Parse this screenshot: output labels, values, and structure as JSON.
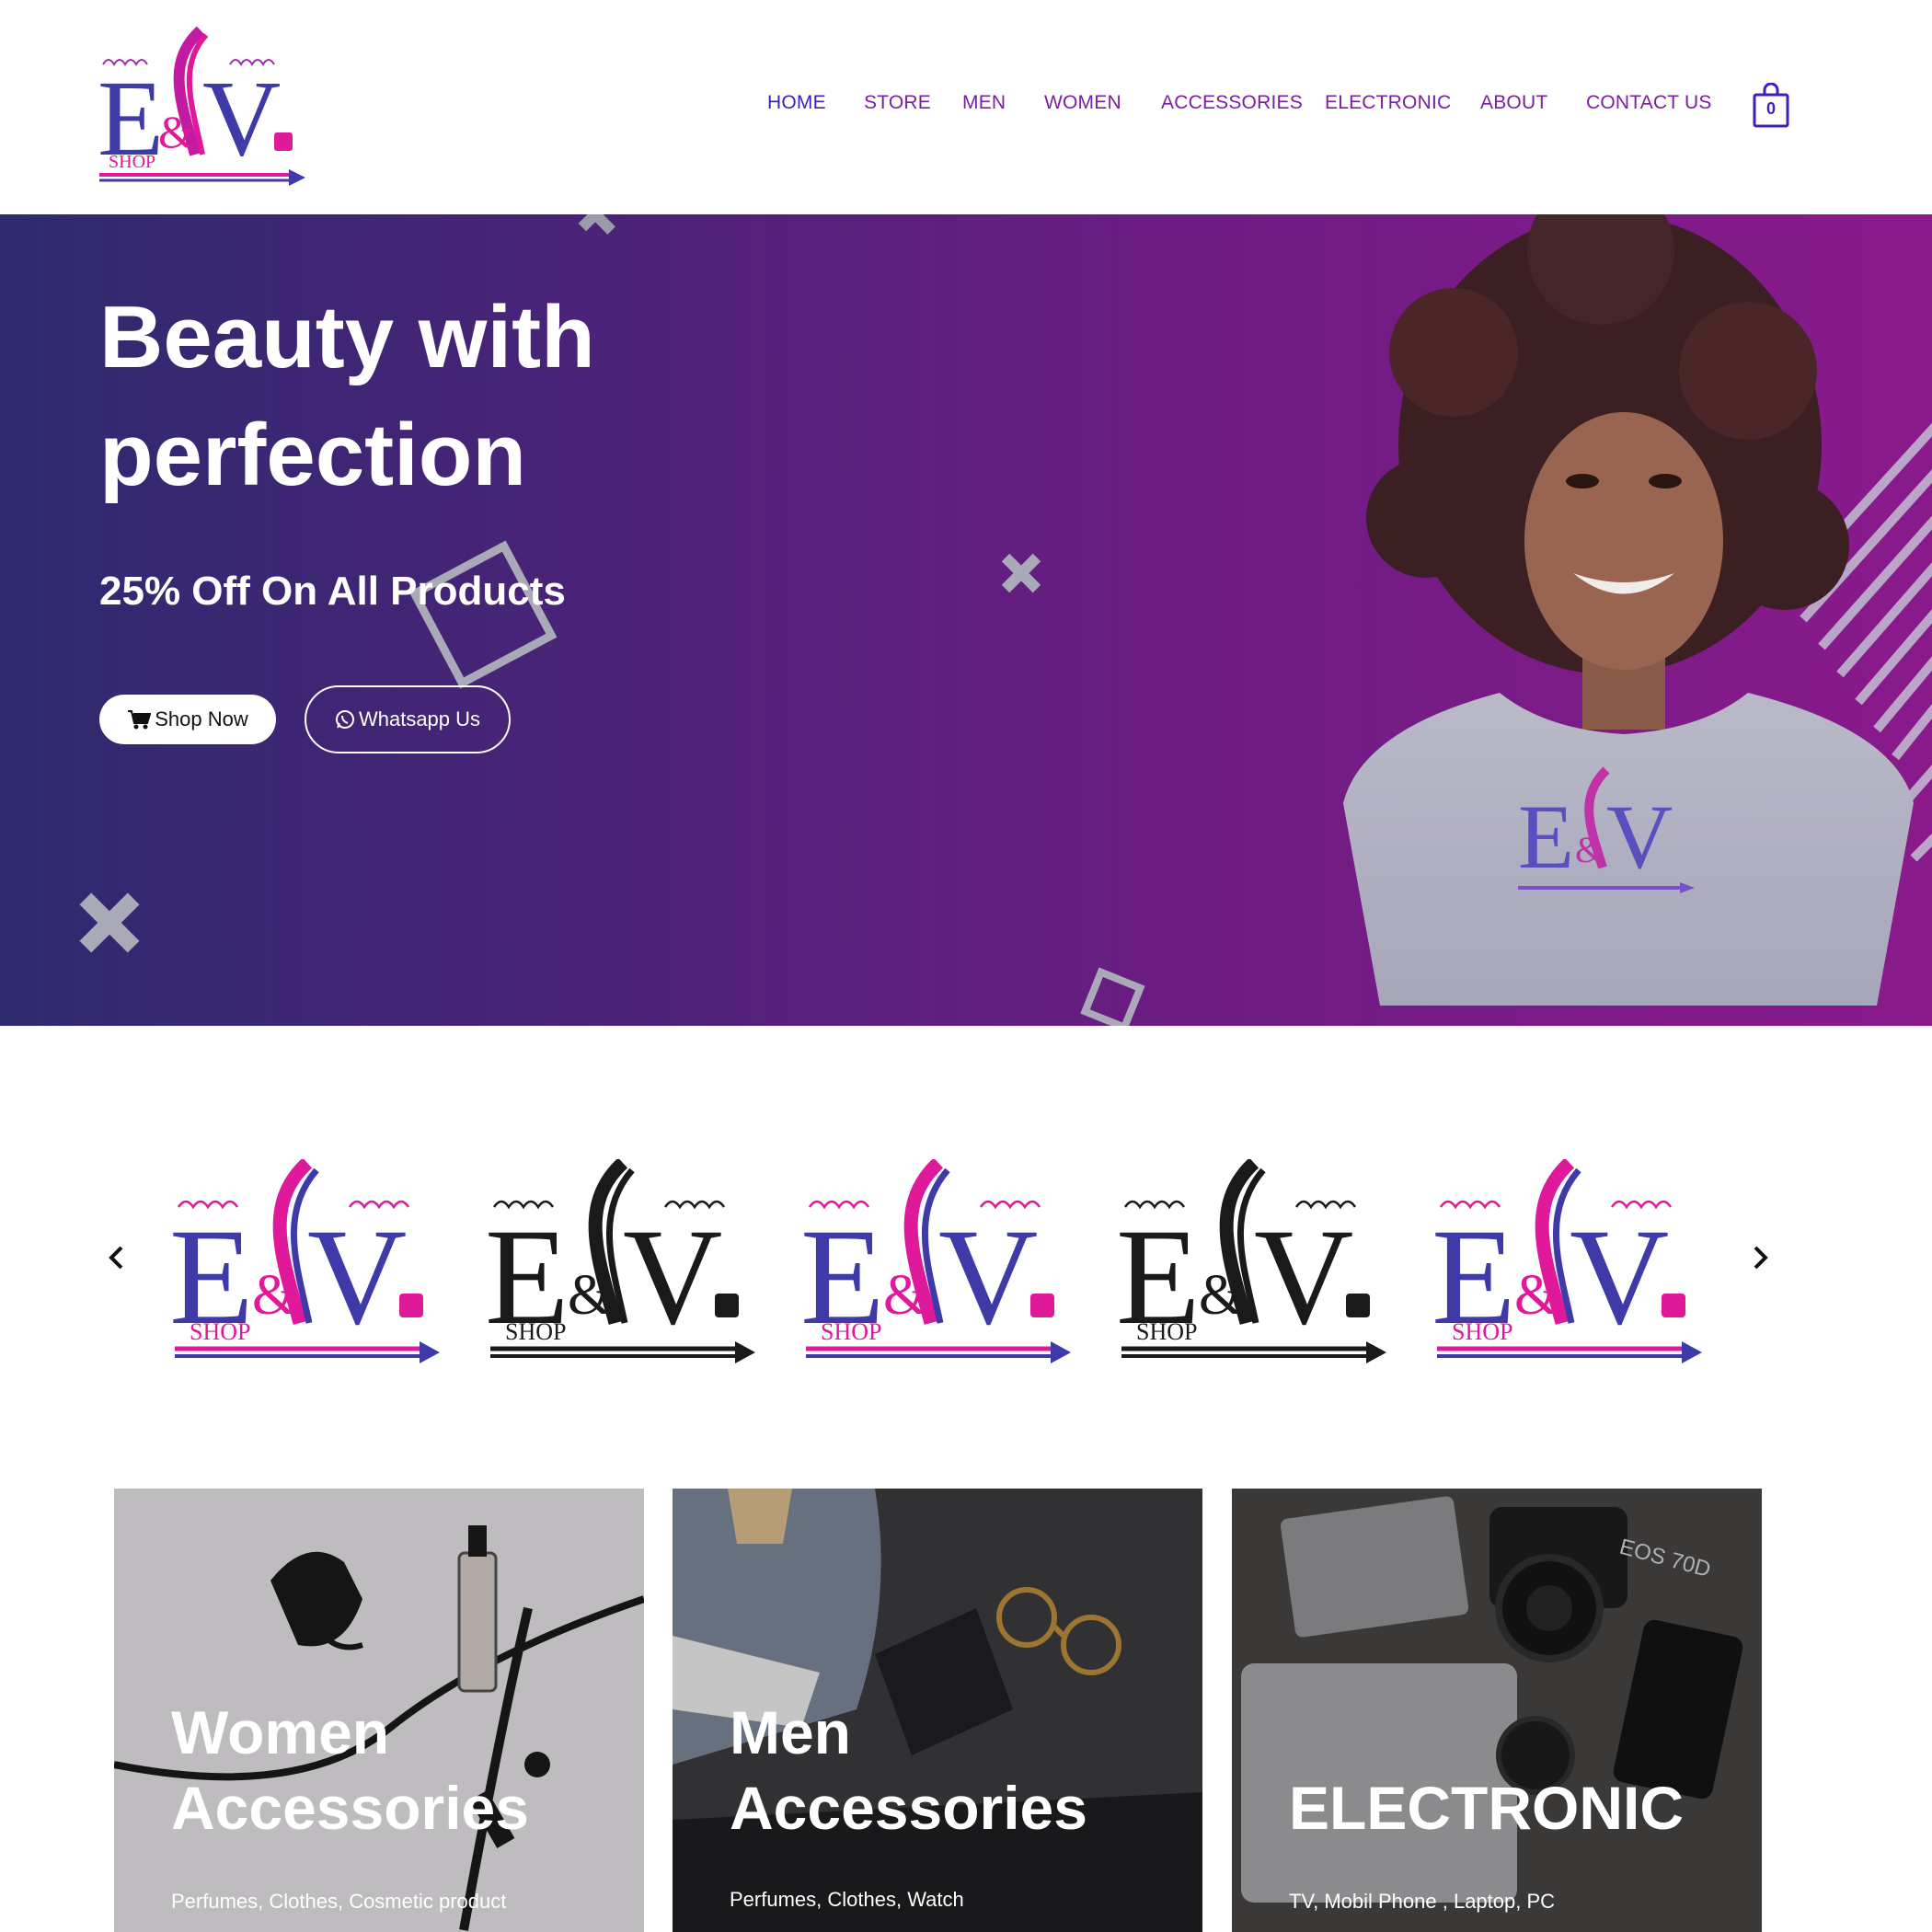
{
  "brand": {
    "logo_name": "E&V Shop",
    "logo_sub": "SHOP"
  },
  "nav": {
    "items": [
      {
        "label": "HOME"
      },
      {
        "label": "STORE"
      },
      {
        "label": "MEN"
      },
      {
        "label": "WOMEN"
      },
      {
        "label": "ACCESSORIES"
      },
      {
        "label": "ELECTRONIC"
      },
      {
        "label": "ABOUT"
      },
      {
        "label": "CONTACT US"
      }
    ],
    "cart_count": "0"
  },
  "hero": {
    "title_line1": "Beauty with",
    "title_line2": "perfection",
    "subtitle": "25% Off On All Products",
    "shop_button": "Shop Now",
    "whatsapp_button": "Whatsapp Us",
    "tshirt_logo": "E&V"
  },
  "brands": [
    {
      "variant": "color"
    },
    {
      "variant": "black"
    },
    {
      "variant": "color"
    },
    {
      "variant": "black"
    },
    {
      "variant": "color"
    }
  ],
  "categories": [
    {
      "title_line1": "Women",
      "title_line2": "Accessories",
      "description": "Perfumes, Clothes, Cosmetic product"
    },
    {
      "title_line1": "Men",
      "title_line2": "Accessories",
      "description": "Perfumes, Clothes, Watch"
    },
    {
      "title_line1": "",
      "title_line2": "ELECTRONIC",
      "description": "TV, Mobil Phone , Laptop, PC"
    }
  ],
  "colors": {
    "nav_text": "#7a1fa2",
    "nav_active": "#3f1fb8",
    "logo_blue": "#3e3aa8",
    "logo_pink": "#e0199a",
    "hero_left": "#2e2a6e",
    "hero_right": "#8a1a8c"
  }
}
